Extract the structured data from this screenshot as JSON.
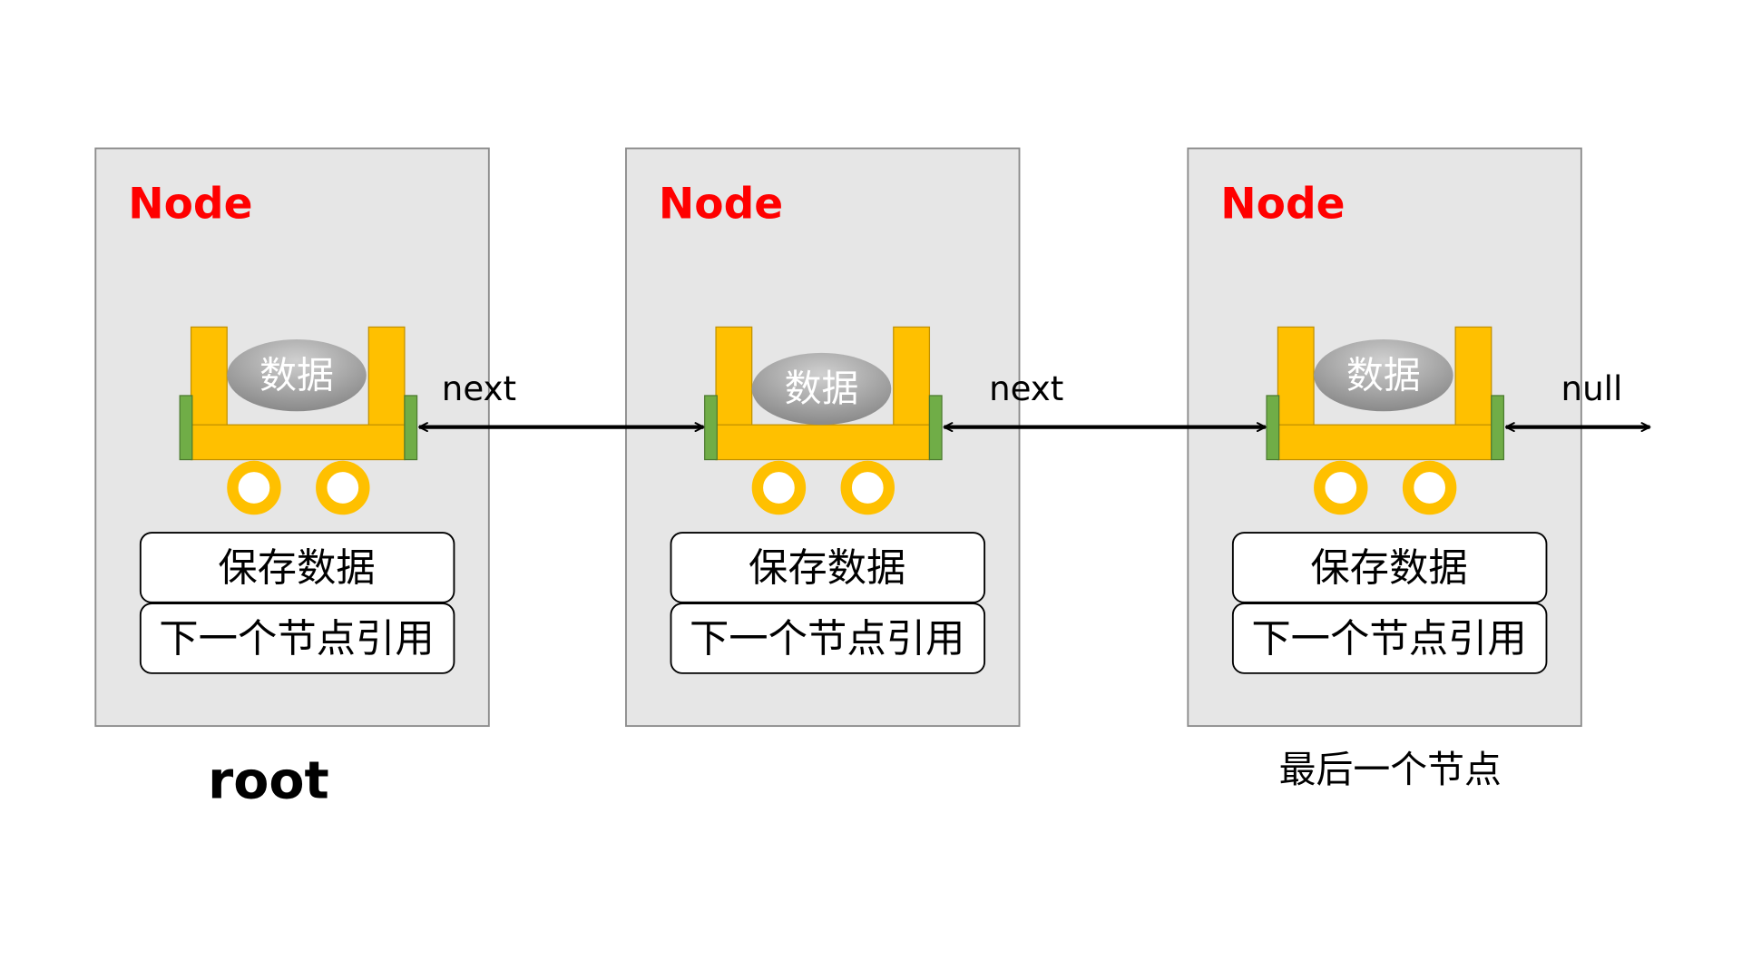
{
  "nodes": [
    {
      "title": "Node",
      "data_label": "数据",
      "field_data": "保存数据",
      "field_next": "下一个节点引用"
    },
    {
      "title": "Node",
      "data_label": "数据",
      "field_data": "保存数据",
      "field_next": "下一个节点引用"
    },
    {
      "title": "Node",
      "data_label": "数据",
      "field_data": "保存数据",
      "field_next": "下一个节点引用"
    }
  ],
  "links": [
    "next",
    "next",
    "null"
  ],
  "root_label": "root",
  "last_node_label": "最后一个节点",
  "colors": {
    "panel": "#e6e6e6",
    "panel_border": "#8c8c8c",
    "cart": "#ffc000",
    "cart_border": "#c09000",
    "connector": "#70ad47",
    "connector_border": "#4c7a30",
    "ellipse": "#a6a6a6",
    "arrow": "#000000",
    "title": "#ff0000"
  }
}
